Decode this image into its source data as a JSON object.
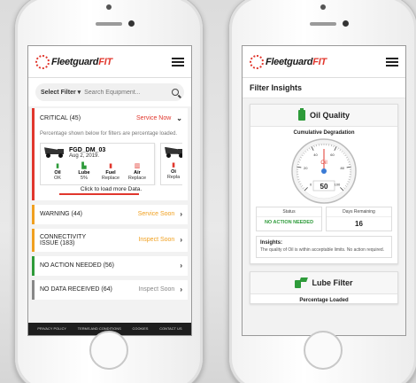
{
  "brand": {
    "name_part1": "Fleetguard",
    "name_part2": "FIT",
    "accent": "#e1372d",
    "green": "#2e9b3a"
  },
  "left_screen": {
    "filter": {
      "select_label": "Select Filter ▾",
      "search_placeholder": "Search Equipment..."
    },
    "sections": {
      "critical": {
        "label": "CRITICAL (45)",
        "status": "Service Now",
        "note": "Percentage shown below for filters are percentage loaded."
      },
      "warning": {
        "label": "WARNING (44)",
        "status": "Service Soon"
      },
      "connectivity": {
        "label": "CONNECTIVITY ISSUE (183)",
        "status": "Inspect Soon"
      },
      "no_action": {
        "label": "NO ACTION NEEDED (56)",
        "status": ""
      },
      "no_data": {
        "label": "NO DATA RECEIVED (64)",
        "status": "Inspect Soon"
      }
    },
    "equipment": {
      "name": "FGD_DM_03",
      "date": "Aug 2, 2019.",
      "items": [
        {
          "label": "Oil",
          "value": "OK",
          "icon": "oil-icon",
          "color": "green"
        },
        {
          "label": "Lube",
          "value": "5%",
          "icon": "lube-icon",
          "color": "green"
        },
        {
          "label": "Fuel",
          "value": "Replace",
          "icon": "fuel-icon",
          "color": "red"
        },
        {
          "label": "Air",
          "value": "Replace",
          "icon": "air-icon",
          "color": "red"
        }
      ],
      "partial": {
        "label": "Oi",
        "value": "Repla"
      },
      "load_more": "Click to load more Data."
    },
    "footer": [
      "PRIVACY POLICY",
      "TERMS AND CONDITIONS",
      "COOKIES",
      "CONTACT US"
    ]
  },
  "right_screen": {
    "title": "Filter Insights",
    "oil_panel": {
      "title": "Oil Quality",
      "subtitle": "Cumulative Degradation",
      "gauge": {
        "value": 50,
        "min": 0,
        "max": 100,
        "label": "Oil",
        "readout": "50",
        "ticks": [
          "0",
          "20",
          "40",
          "60",
          "80",
          "100"
        ]
      },
      "status_label": "Status",
      "status_value": "NO ACTION NEEDED",
      "days_label": "Days Remaining",
      "days_value": "16",
      "insights_heading": "Insights:",
      "insights_text": "The quality of Oil is within acceptable limits. No action required."
    },
    "lube_panel": {
      "title": "Lube Filter",
      "subtitle": "Percentage Loaded"
    }
  }
}
